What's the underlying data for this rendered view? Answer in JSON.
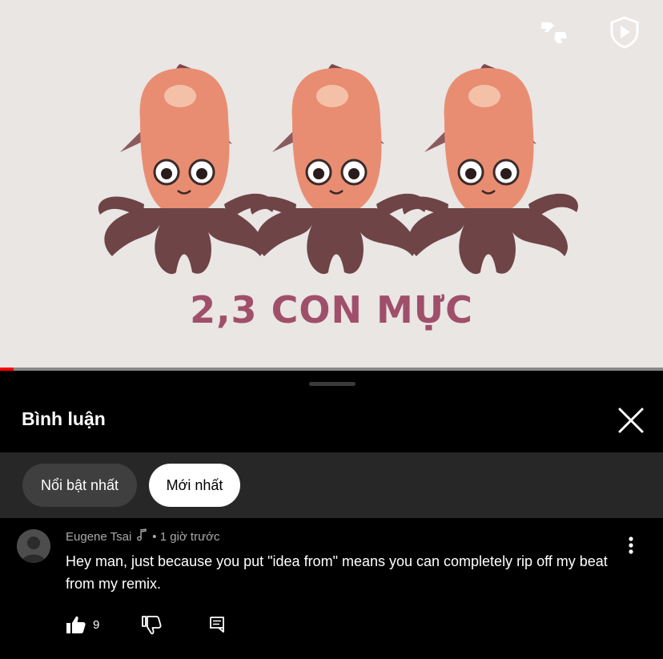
{
  "video": {
    "caption": "2,3 CON MỰC",
    "progress_fraction": 0.02,
    "icons": [
      "feedback-icon",
      "shield-play-icon"
    ]
  },
  "sheet": {
    "title": "Bình luận",
    "close_icon": "close-icon"
  },
  "filters": {
    "top": "Nổi bật nhất",
    "newest": "Mới nhất",
    "selected": "newest"
  },
  "comment": {
    "author": "Eugene Tsai",
    "time": "• 1 giờ trước",
    "text": "Hey man, just because you put \"idea from\" means you can completely rip off my beat from my remix.",
    "likes": "9",
    "icons": [
      "music-note-icon",
      "thumbs-up-icon",
      "thumbs-down-icon",
      "reply-icon",
      "more-vert-icon"
    ]
  },
  "colors": {
    "accent_red": "#ff0000",
    "caption": "#a04f6a",
    "sheet_bg": "#000000",
    "chip_bar": "#272727"
  }
}
